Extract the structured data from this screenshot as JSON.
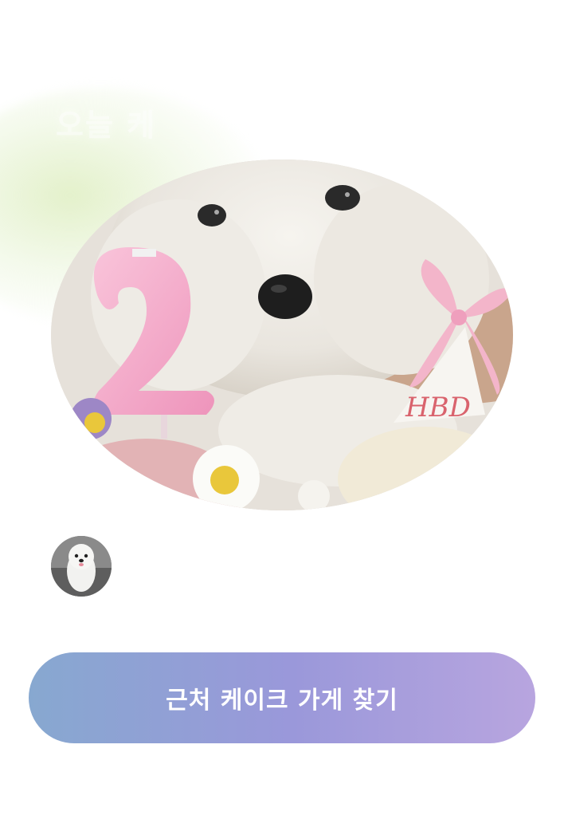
{
  "header": {
    "faded_title": "오늘 케"
  },
  "photo": {
    "alt": "Puppy birthday photo",
    "hat_text": "HBD",
    "candle_number": "2"
  },
  "profile": {
    "avatar_alt": "Profile avatar"
  },
  "cta": {
    "label": "근처 케이크 가게 찾기"
  },
  "colors": {
    "cta_gradient_start": "#87a8d0",
    "cta_gradient_mid": "#9a98da",
    "cta_gradient_end": "#b8a5df",
    "glow": "#e2f0c8",
    "candle": "#f4a9c8"
  }
}
